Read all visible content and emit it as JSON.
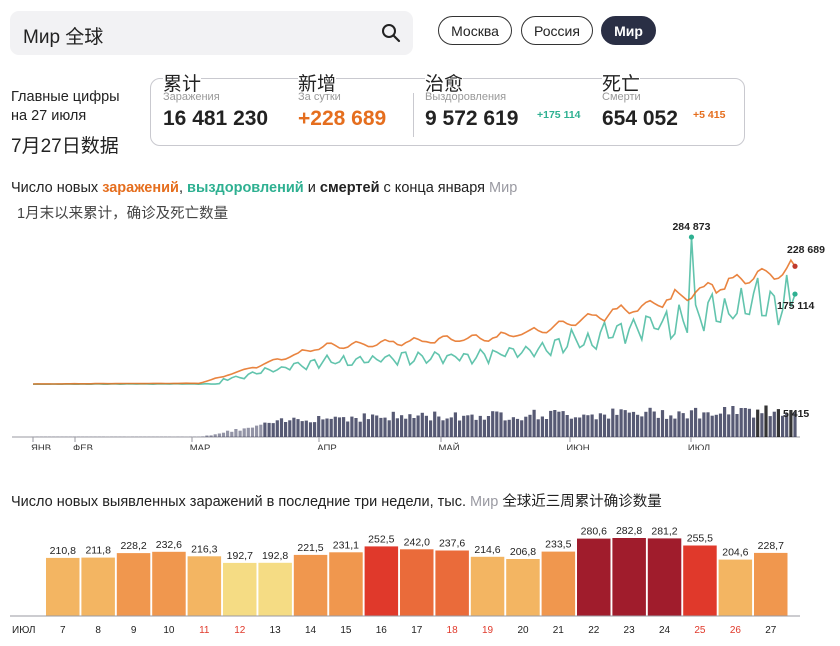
{
  "search": {
    "value": "Мир 全球"
  },
  "region_tabs": [
    {
      "label": "Москва",
      "active": false
    },
    {
      "label": "Россия",
      "active": false
    },
    {
      "label": "Мир",
      "active": true
    }
  ],
  "summary": {
    "title_line1": "Главные цифры",
    "title_line2": "на 27 июля",
    "title_zh": "7月27日数据",
    "stats": [
      {
        "zh": "累计",
        "ru": "Заражения",
        "value": "16 481 230",
        "delta": "",
        "color": "#222222"
      },
      {
        "zh": "新增",
        "ru": "За сутки",
        "value": "+228 689",
        "delta": "",
        "color": "#e56e1e"
      },
      {
        "zh": "治愈",
        "ru": "Выздоровления",
        "value": "9 572 619",
        "delta": "+175 114",
        "delta_color": "#2eb091",
        "color": "#222222"
      },
      {
        "zh": "死亡",
        "ru": "Смерти",
        "value": "654 052",
        "delta": "+5 415",
        "delta_color": "#e56e1e",
        "color": "#222222"
      }
    ]
  },
  "trend_chart": {
    "title_parts": {
      "p1": "Число новых ",
      "p2": "заражений",
      "p3": ", ",
      "p4": "выздоровлений",
      "p5": " и ",
      "p6": "смертей",
      "p7": " с конца января",
      "p8": " Мир"
    },
    "subtitle": "1月末以来累计，确诊及死亡数量",
    "colors": {
      "infections": "#e56e1e",
      "recoveries": "#2eb091",
      "deaths": "#3a3d5c",
      "deaths_highlight": "#111111"
    }
  },
  "chart_data": [
    {
      "type": "line",
      "title": "Число новых заражений, выздоровлений и смертей с конца января",
      "x_tick_labels": [
        "ЯНВ",
        "ФЕВ",
        "МАР",
        "АПР",
        "МАЙ",
        "ИЮН",
        "ИЮЛ"
      ],
      "series": [
        {
          "name": "заражений",
          "last_value": 228689
        },
        {
          "name": "выздоровлений",
          "peak_value": 284873,
          "last_value": 175114
        },
        {
          "name": "смертей",
          "last_value": 5415
        }
      ],
      "annotations": [
        "284 873",
        "228 689",
        "175 114",
        "5 415"
      ]
    },
    {
      "type": "bar",
      "title": "Число новых выявленных заражений в последние три недели, тыс.",
      "title_suffix": " Мир",
      "title_zh": "全球近三周累计确诊数量",
      "month_label": "ИЮЛ",
      "categories": [
        "7",
        "8",
        "9",
        "10",
        "11",
        "12",
        "13",
        "14",
        "15",
        "16",
        "17",
        "18",
        "19",
        "20",
        "21",
        "22",
        "23",
        "24",
        "25",
        "26",
        "27"
      ],
      "values": [
        210.8,
        211.8,
        228.2,
        232.6,
        216.3,
        192.7,
        192.8,
        221.5,
        231.1,
        252.5,
        242.0,
        237.6,
        214.6,
        206.8,
        233.5,
        280.6,
        282.8,
        281.2,
        255.5,
        204.6,
        228.7
      ],
      "value_labels": [
        "210,8",
        "211,8",
        "228,2",
        "232,6",
        "216,3",
        "192,7",
        "192,8",
        "221,5",
        "231,1",
        "252,5",
        "242,0",
        "237,6",
        "214,6",
        "206,8",
        "233,5",
        "280,6",
        "282,8",
        "281,2",
        "255,5",
        "204,6",
        "228,7"
      ],
      "weekend_days": [
        "11",
        "12",
        "18",
        "19",
        "25",
        "26"
      ],
      "weekend_color": "#e0392b"
    }
  ]
}
